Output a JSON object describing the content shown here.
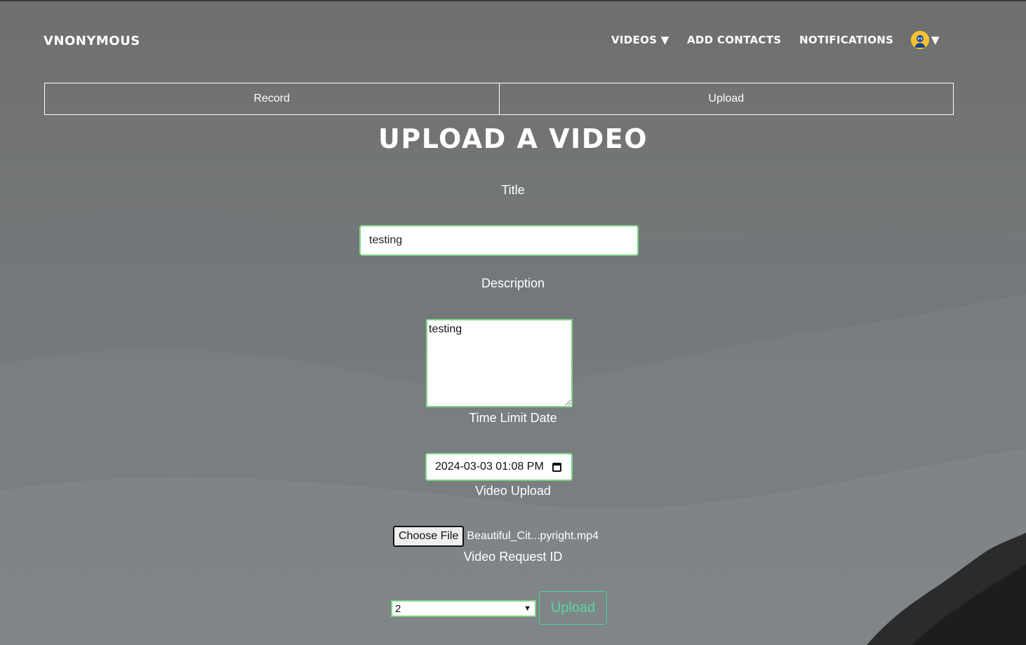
{
  "brand": "VNONYMOUS",
  "nav": {
    "videos": "VIDEOS ▼",
    "add_contacts": "ADD CONTACTS",
    "notifications": "NOTIFICATIONS",
    "avatar_caret": "▼"
  },
  "tabs": [
    {
      "label": "Record"
    },
    {
      "label": "Upload"
    }
  ],
  "page_title": "UPLOAD A VIDEO",
  "form": {
    "title_label": "Title",
    "title_value": "testing",
    "description_label": "Description",
    "description_value": "testing",
    "time_limit_label": "Time Limit Date",
    "time_limit_value": "2024-03-03 01:08  PM",
    "video_upload_label": "Video Upload",
    "choose_file_label": "Choose File",
    "file_name": "Beautiful_Cit...pyright.mp4",
    "request_id_label": "Video Request ID",
    "request_id_value": "2",
    "submit_label": "Upload"
  },
  "colors": {
    "field_border": "#7ed488",
    "submit_accent": "#55d9a2",
    "avatar": "#f2c230"
  },
  "icons": {
    "avatar": "user-avatar-icon",
    "calendar": "calendar-icon",
    "dropdown": "chevron-down-icon"
  }
}
